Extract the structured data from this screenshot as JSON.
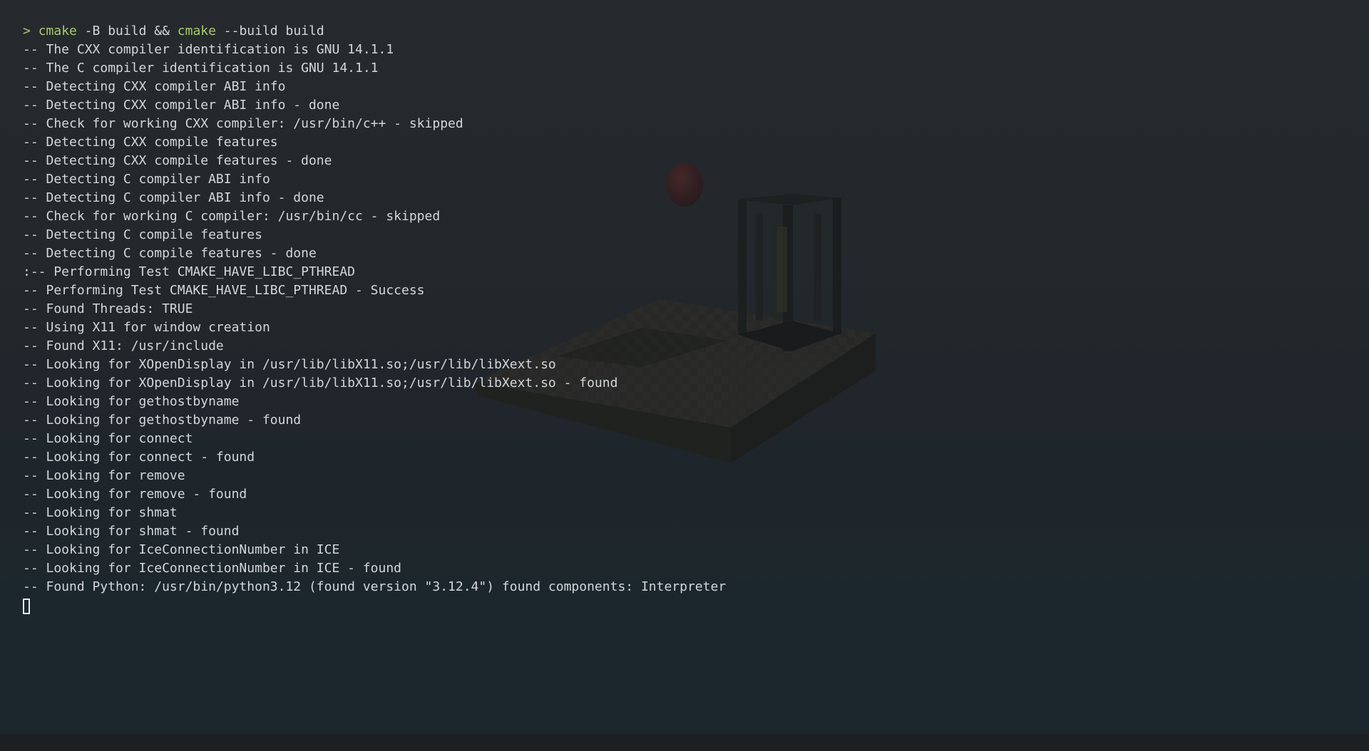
{
  "terminal": {
    "prompt": {
      "arrow": ">",
      "cmd1": "cmake",
      "args1": " -B build && ",
      "cmd2": "cmake",
      "args2": " --build build"
    },
    "lines": [
      "-- The CXX compiler identification is GNU 14.1.1",
      "-- The C compiler identification is GNU 14.1.1",
      "-- Detecting CXX compiler ABI info",
      "-- Detecting CXX compiler ABI info - done",
      "-- Check for working CXX compiler: /usr/bin/c++ - skipped",
      "-- Detecting CXX compile features",
      "-- Detecting CXX compile features - done",
      "-- Detecting C compiler ABI info",
      "-- Detecting C compiler ABI info - done",
      "-- Check for working C compiler: /usr/bin/cc - skipped",
      "-- Detecting C compile features",
      "-- Detecting C compile features - done",
      ":-- Performing Test CMAKE_HAVE_LIBC_PTHREAD",
      "-- Performing Test CMAKE_HAVE_LIBC_PTHREAD - Success",
      "-- Found Threads: TRUE",
      "-- Using X11 for window creation",
      "-- Found X11: /usr/include",
      "-- Looking for XOpenDisplay in /usr/lib/libX11.so;/usr/lib/libXext.so",
      "-- Looking for XOpenDisplay in /usr/lib/libX11.so;/usr/lib/libXext.so - found",
      "-- Looking for gethostbyname",
      "-- Looking for gethostbyname - found",
      "-- Looking for connect",
      "-- Looking for connect - found",
      "-- Looking for remove",
      "-- Looking for remove - found",
      "-- Looking for shmat",
      "-- Looking for shmat - found",
      "-- Looking for IceConnectionNumber in ICE",
      "-- Looking for IceConnectionNumber in ICE - found",
      "-- Found Python: /usr/bin/python3.12 (found version \"3.12.4\") found components: Interpreter"
    ]
  },
  "colors": {
    "text": "#d3d7d9",
    "prompt_accent": "#a8c96b",
    "background": "#1c2a32"
  }
}
